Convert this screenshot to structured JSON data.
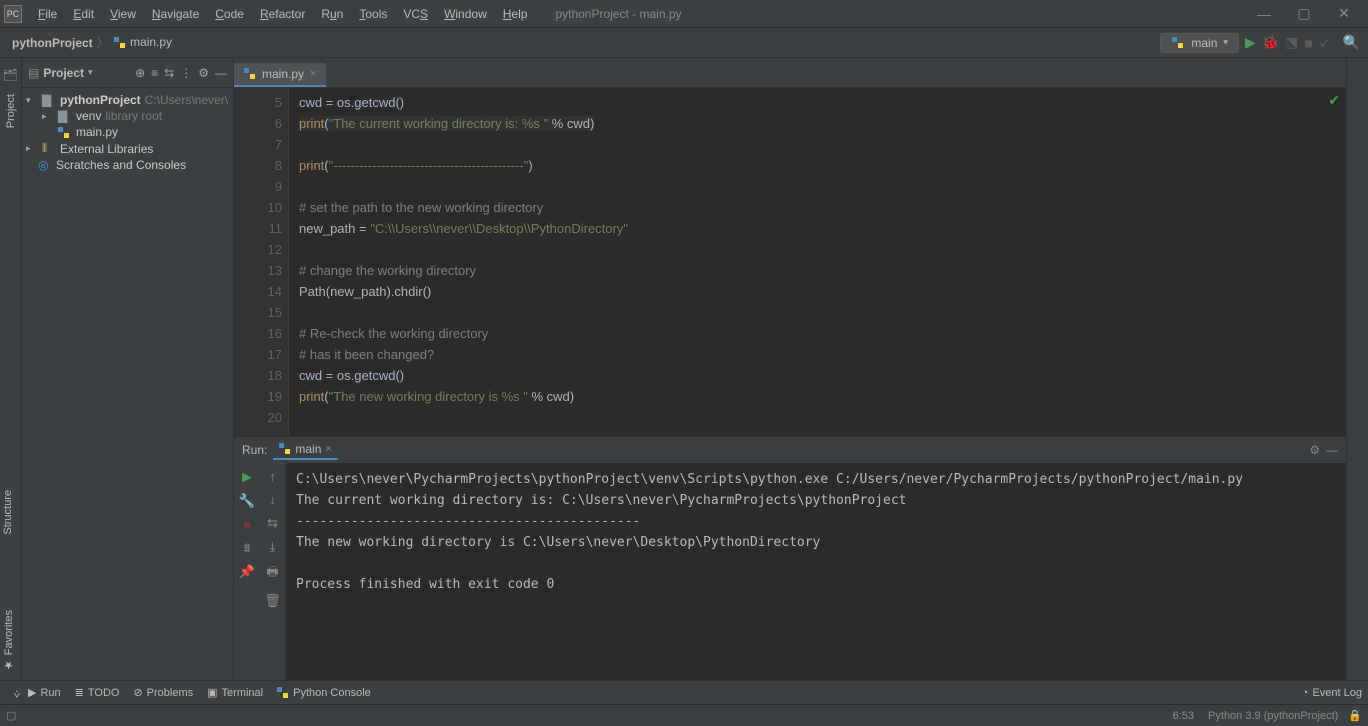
{
  "window": {
    "title": "pythonProject - main.py",
    "menu": [
      "File",
      "Edit",
      "View",
      "Navigate",
      "Code",
      "Refactor",
      "Run",
      "Tools",
      "VCS",
      "Window",
      "Help"
    ]
  },
  "breadcrumbs": {
    "project": "pythonProject",
    "file": "main.py"
  },
  "run_config": {
    "name": "main"
  },
  "project_panel": {
    "title": "Project",
    "root_name": "pythonProject",
    "root_path": "C:\\Users\\never\\",
    "venv_name": "venv",
    "venv_hint": "library root",
    "file1": "main.py",
    "ext_lib": "External Libraries",
    "scratch": "Scratches and Consoles"
  },
  "editor": {
    "tab_name": "main.py",
    "line_start": 5,
    "lines": {
      "l5": "cwd = os.getcwd()",
      "l6a": "print",
      "l6b": "(",
      "l6c": "\"The current working directory is: %s \"",
      "l6d": " % cwd)",
      "l7": "",
      "l8a": "print",
      "l8b": "(",
      "l8c": "\"--------------------------------------------\"",
      "l8d": ")",
      "l9": "",
      "l10": "# set the path to the new working directory",
      "l11a": "new_path = ",
      "l11b": "\"C:\\\\Users\\\\never\\\\Desktop\\\\PythonDirectory\"",
      "l12": "",
      "l13": "# change the working directory",
      "l14": "Path(new_path).chdir()",
      "l15": "",
      "l16": "# Re-check the working directory",
      "l17": "# has it been changed?",
      "l18": "cwd = os.getcwd()",
      "l19a": "print",
      "l19b": "(",
      "l19c": "\"The new working directory is %s \"",
      "l19d": " % cwd)",
      "l20": ""
    }
  },
  "run_panel": {
    "label": "Run:",
    "tab": "main",
    "output": "C:\\Users\\never\\PycharmProjects\\pythonProject\\venv\\Scripts\\python.exe C:/Users/never/PycharmProjects/pythonProject/main.py\nThe current working directory is: C:\\Users\\never\\PycharmProjects\\pythonProject \n--------------------------------------------\nThe new working directory is C:\\Users\\never\\Desktop\\PythonDirectory \n\nProcess finished with exit code 0"
  },
  "bottom_tools": {
    "run": "Run",
    "todo": "TODO",
    "problems": "Problems",
    "terminal": "Terminal",
    "py_console": "Python Console",
    "event_log": "Event Log"
  },
  "status": {
    "caret": "6:53",
    "interp": "Python 3.9 (pythonProject)"
  }
}
